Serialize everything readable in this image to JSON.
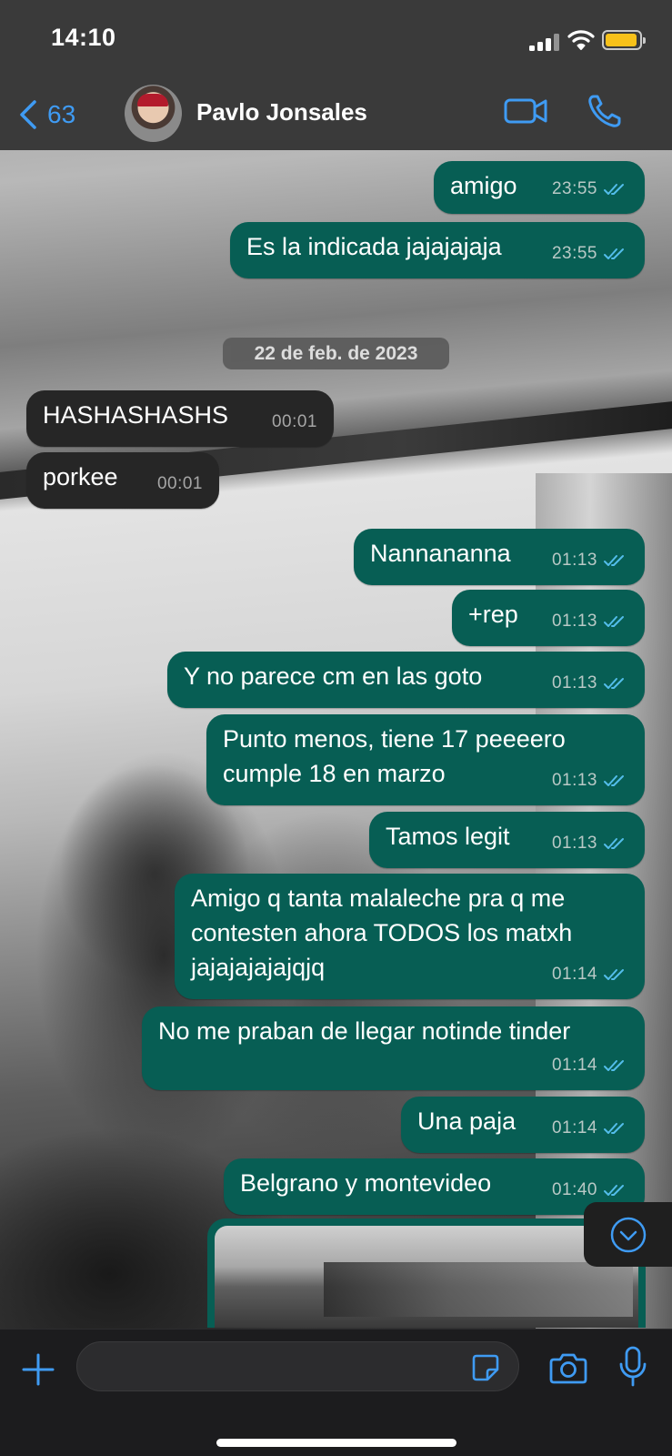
{
  "status_bar": {
    "time": "14:10"
  },
  "header": {
    "back_count": "63",
    "contact_name": "Pavlo Jonsales"
  },
  "date_separator": "22 de feb. de 2023",
  "messages": [
    {
      "dir": "out",
      "text": "amigo",
      "time": "23:55",
      "read": true
    },
    {
      "dir": "out",
      "text": "Es la indicada jajajajaja",
      "time": "23:55",
      "read": true
    },
    {
      "dir": "in",
      "text": "HASHASHASHS",
      "time": "00:01"
    },
    {
      "dir": "in",
      "text": "porkee",
      "time": "00:01"
    },
    {
      "dir": "out",
      "text": "Nannananna",
      "time": "01:13",
      "read": true
    },
    {
      "dir": "out",
      "text": "+rep",
      "time": "01:13",
      "read": true
    },
    {
      "dir": "out",
      "text": "Y no parece cm en las goto",
      "time": "01:13",
      "read": true
    },
    {
      "dir": "out",
      "text": "Punto menos, tiene 17 peeeero\ncumple 18 en marzo",
      "time": "01:13",
      "read": true
    },
    {
      "dir": "out",
      "text": "Tamos legit",
      "time": "01:13",
      "read": true
    },
    {
      "dir": "out",
      "text": "Amigo q tanta malaleche pra q me\ncontesten ahora TODOS los matxh\njajajajajajqjq",
      "time": "01:14",
      "read": true
    },
    {
      "dir": "out",
      "text": "No me praban de llegar notinde tinder",
      "time": "01:14",
      "read": true
    },
    {
      "dir": "out",
      "text": "Una paja",
      "time": "01:14",
      "read": true
    },
    {
      "dir": "out",
      "text": "Belgrano y montevideo",
      "time": "01:40",
      "read": true
    }
  ],
  "input": {
    "value": "",
    "placeholder": ""
  },
  "colors": {
    "accent": "#3f9bf3",
    "outgoing_bubble": "#075e54",
    "incoming_bubble": "#262626",
    "read_ticks": "#53bdeb",
    "battery": "#f7c11a"
  },
  "icons": [
    "back-chevron-icon",
    "video-call-icon",
    "phone-icon",
    "chevron-down-icon",
    "plus-icon",
    "sticker-icon",
    "camera-icon",
    "microphone-icon"
  ]
}
